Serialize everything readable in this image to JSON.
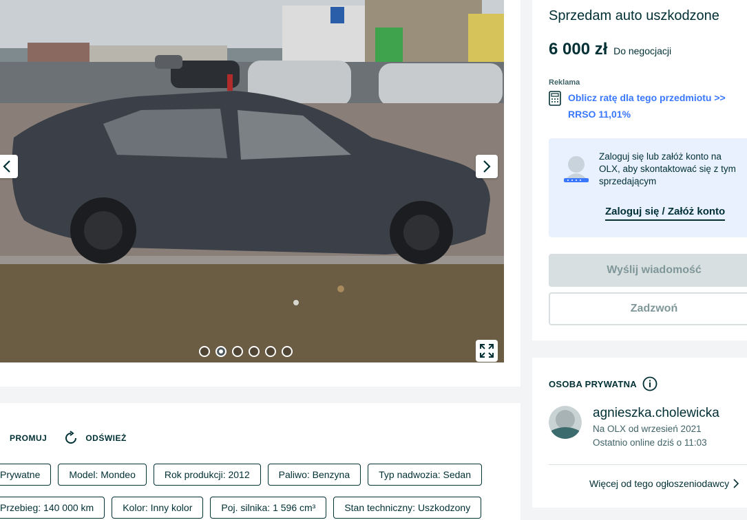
{
  "gallery": {
    "total_images": 6,
    "active_index": 1
  },
  "actions": {
    "promote": "PROMUJ",
    "refresh": "ODŚWIEŻ"
  },
  "tags": {
    "row1": [
      "Prywatne",
      "Model: Mondeo",
      "Rok produkcji: 2012",
      "Paliwo: Benzyna",
      "Typ nadwozia: Sedan"
    ],
    "row2": [
      "Przebieg: 140 000 km",
      "Kolor: Inny kolor",
      "Poj. silnika: 1 596 cm³",
      "Stan techniczny: Uszkodzony"
    ]
  },
  "listing": {
    "title": "Sprzedam auto uszkodzone",
    "price": "6 000 zł",
    "negotiable": "Do negocjacji",
    "ad_label": "Reklama",
    "ad_link": "Oblicz ratę dla tego przedmiotu >> RRSO 11,01%"
  },
  "login": {
    "text": "Zaloguj się lub załóż konto na OLX, aby skontaktować się z tym sprzedającym",
    "link": "Zaloguj się / Załóż konto"
  },
  "buttons": {
    "message": "Wyślij wiadomość",
    "call": "Zadzwoń"
  },
  "seller": {
    "type": "OSOBA PRYWATNA",
    "name": "agnieszka.cholewicka",
    "since": "Na OLX od wrzesień 2021",
    "online": "Ostatnio online dziś o 11:03",
    "more": "Więcej od tego ogłoszeniodawcy"
  },
  "colors": {
    "accent_link": "#3a77ff",
    "primary_text": "#002f34",
    "login_bg": "#e9f1ff",
    "disabled_button": "#d8dfe0"
  }
}
